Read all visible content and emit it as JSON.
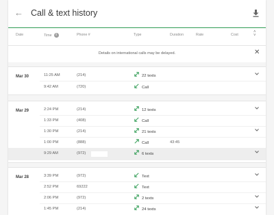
{
  "header": {
    "title": "Call & text history",
    "back_icon": "arrow-left-icon",
    "download_icon": "download-icon"
  },
  "columns": {
    "date": "Date",
    "time": "Time",
    "phone": "Phone #",
    "type": "Type",
    "duration": "Duration",
    "rate": "Rate",
    "cost": "Cost"
  },
  "notice": {
    "text": "Details on international calls may be delayed."
  },
  "groups": [
    {
      "date": "Mar 30",
      "rows": [
        {
          "time": "11:25 AM",
          "phone": "(214)",
          "type": "22 texts",
          "duration": "",
          "icon": "incoming-outgoing-icon"
        },
        {
          "time": "9:42 AM",
          "phone": "(720)",
          "type": "Call",
          "duration": "",
          "icon": "incoming-icon"
        }
      ]
    },
    {
      "date": "Mar 29",
      "rows": [
        {
          "time": "2:24 PM",
          "phone": "(214)",
          "type": "12 texts",
          "duration": "",
          "icon": "incoming-outgoing-icon"
        },
        {
          "time": "1:33 PM",
          "phone": "(408)",
          "type": "Call",
          "duration": "",
          "icon": "incoming-icon"
        },
        {
          "time": "1:30 PM",
          "phone": "(214)",
          "type": "21 texts",
          "duration": "",
          "icon": "incoming-outgoing-icon"
        },
        {
          "time": "1:00 PM",
          "phone": "(888)",
          "type": "Call",
          "duration": "43:45",
          "icon": "outgoing-icon"
        },
        {
          "time": "9:29 AM",
          "phone": "(972)",
          "type": "6 texts",
          "duration": "",
          "icon": "incoming-outgoing-icon"
        }
      ]
    },
    {
      "date": "Mar 28",
      "rows": [
        {
          "time": "3:39 PM",
          "phone": "(972)",
          "type": "Text",
          "duration": "",
          "icon": "incoming-icon"
        },
        {
          "time": "2:52 PM",
          "phone": "69222",
          "type": "Text",
          "duration": "",
          "icon": "incoming-icon"
        },
        {
          "time": "2:06 PM",
          "phone": "(972)",
          "type": "2 texts",
          "duration": "",
          "icon": "incoming-outgoing-icon"
        },
        {
          "time": "1:45 PM",
          "phone": "(214)",
          "type": "24 texts",
          "duration": "",
          "icon": "incoming-outgoing-icon"
        }
      ]
    }
  ],
  "colors": {
    "accent_green": "#2e9b52",
    "header_line": "#2e9b52",
    "row_highlight": "#eeeeee"
  }
}
